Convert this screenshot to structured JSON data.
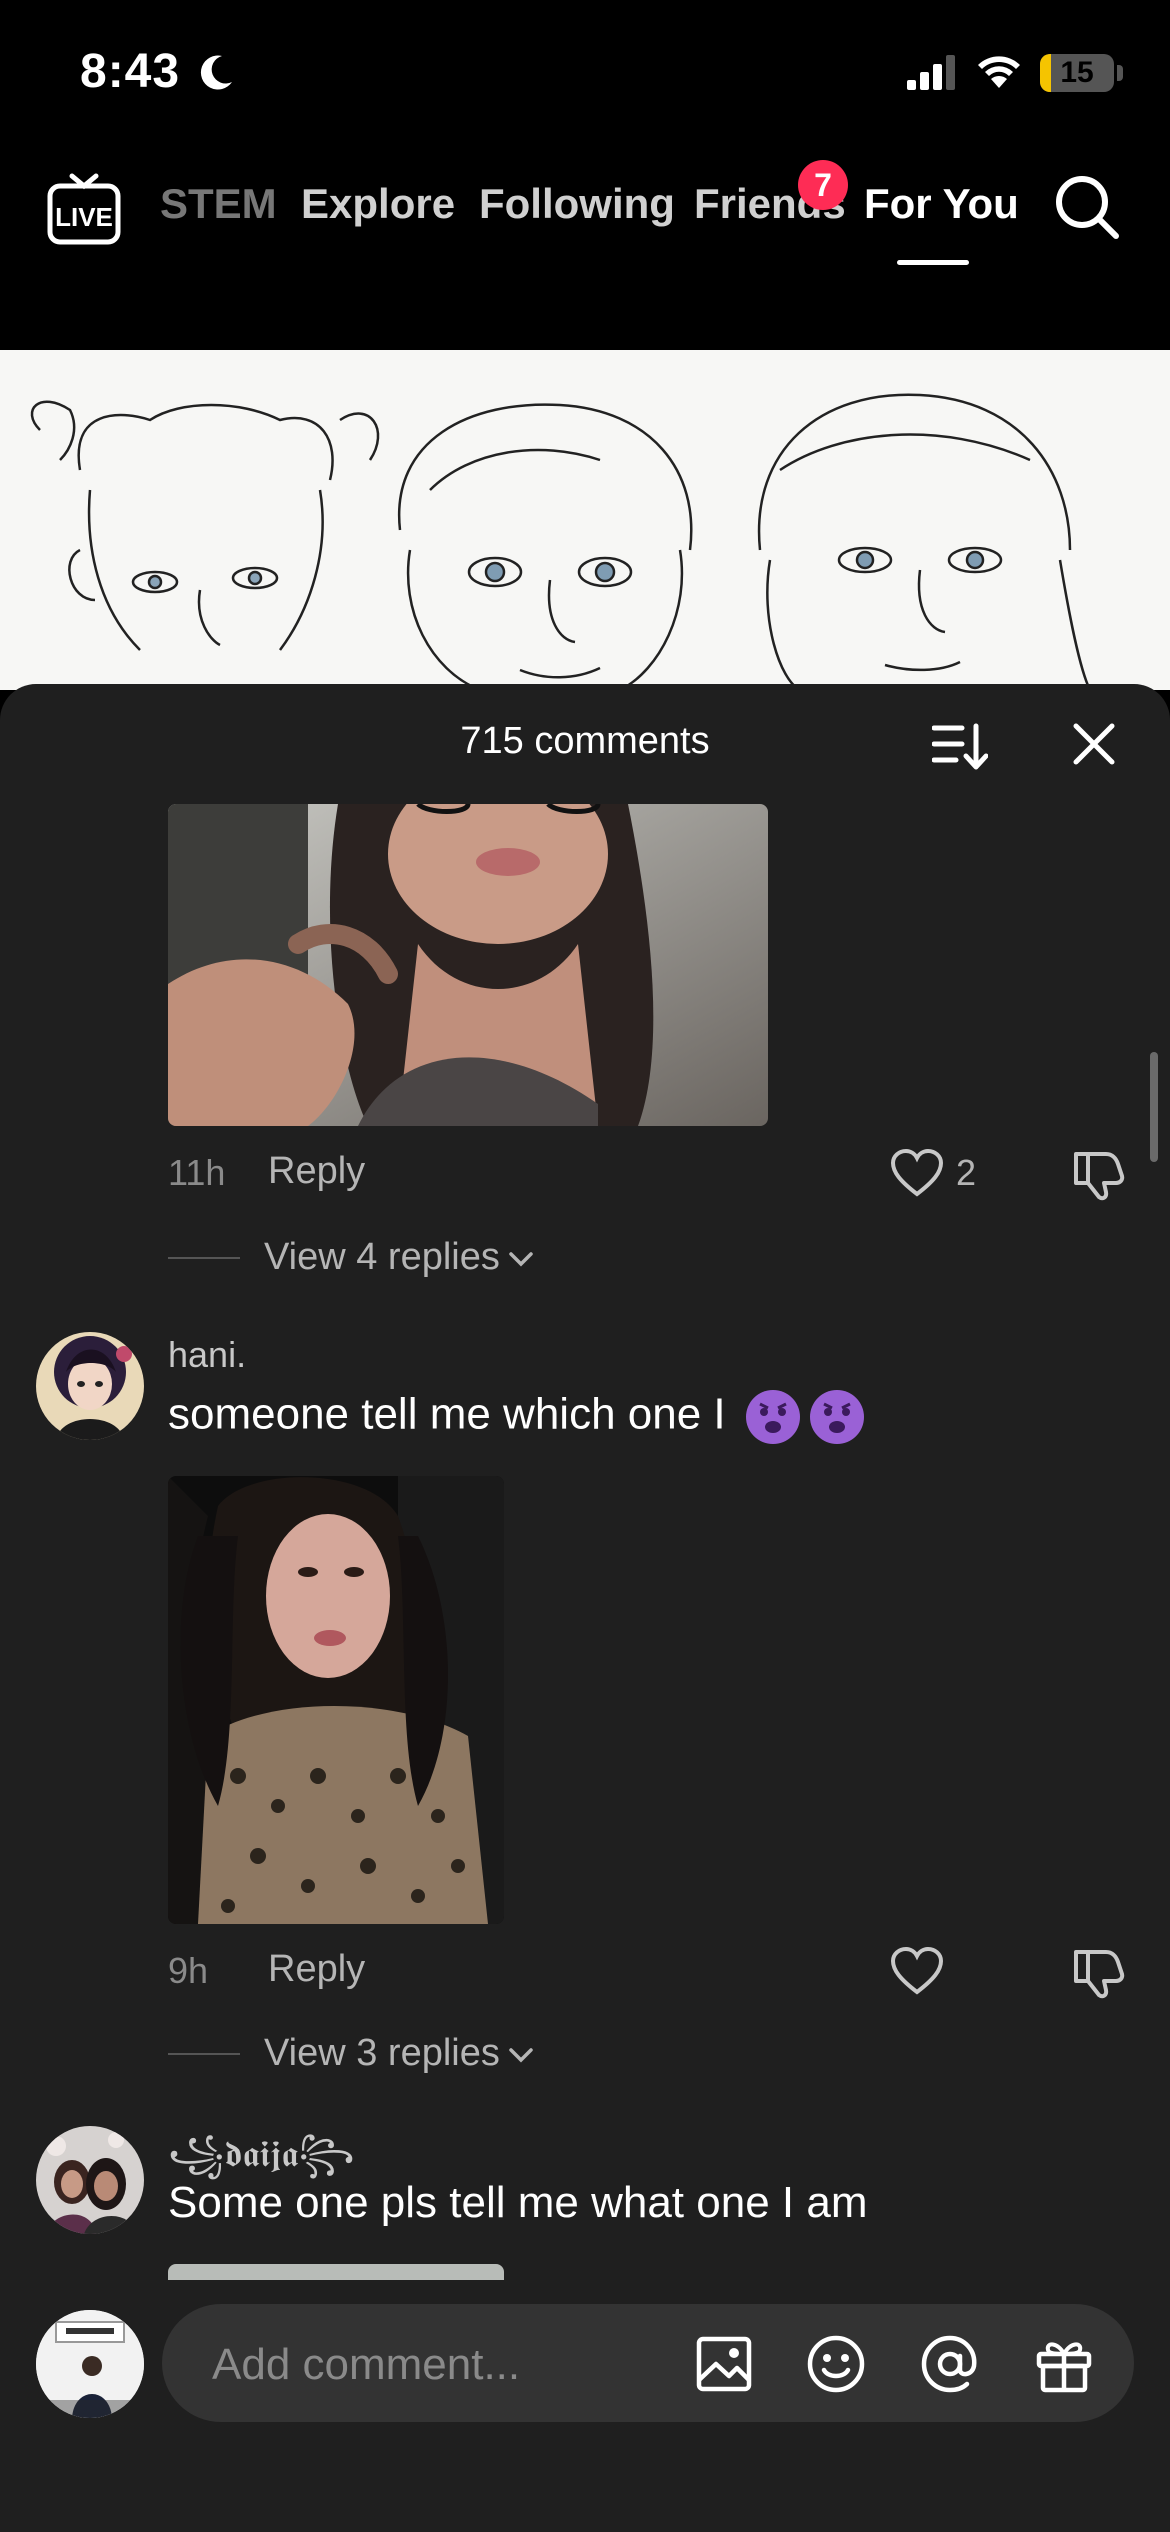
{
  "status_bar": {
    "time": "8:43",
    "battery": "15",
    "battery_color": "#f5c400",
    "icons": [
      "moon-icon",
      "signal-icon",
      "wifi-icon",
      "battery-icon"
    ]
  },
  "top_nav": {
    "live_label": "LIVE",
    "tabs": [
      {
        "label": "STEM"
      },
      {
        "label": "Explore"
      },
      {
        "label": "Following"
      },
      {
        "label": "Friends"
      },
      {
        "label": "For You"
      }
    ],
    "active_tab": "For You",
    "friends_badge": "7",
    "badge_color": "#fe2c55"
  },
  "comments_panel": {
    "title": "715 comments",
    "comments": [
      {
        "time": "11h",
        "reply_label": "Reply",
        "likes": "2",
        "view_replies": "View 4 replies"
      },
      {
        "username": "hani.",
        "text": "someone tell me which one I",
        "time": "9h",
        "reply_label": "Reply",
        "likes": "",
        "view_replies": "View 3 replies"
      },
      {
        "username": "꧁𝖉𝖆𝖎𝖏𝖆꧂",
        "text": "Some one pls tell me what one I am"
      }
    ]
  },
  "input_bar": {
    "placeholder": "Add comment...",
    "icons": [
      "image-icon",
      "emoji-icon",
      "mention-icon",
      "gift-icon"
    ]
  }
}
